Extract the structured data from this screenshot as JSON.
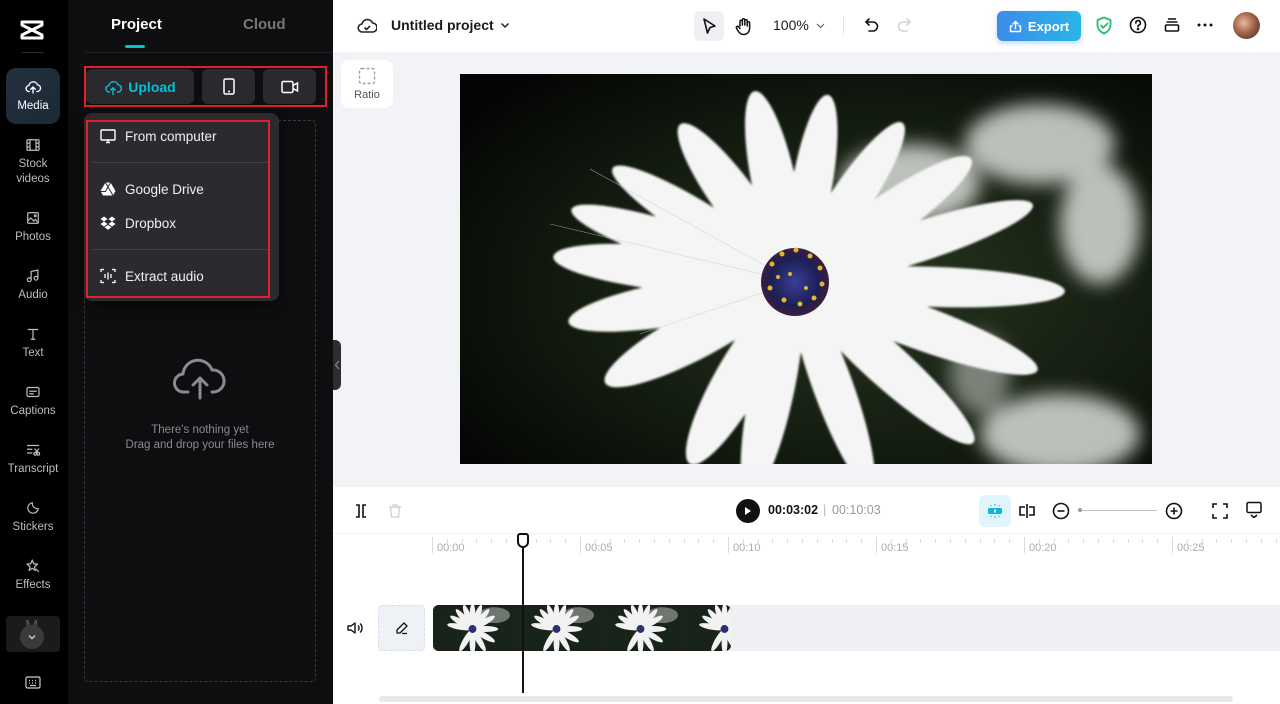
{
  "rail": {
    "items": [
      {
        "id": "media",
        "label": "Media",
        "icon": "cloud-upload-icon",
        "active": true
      },
      {
        "id": "stock-videos",
        "label": "Stock\nvideos",
        "icon": "film-icon"
      },
      {
        "id": "photos",
        "label": "Photos",
        "icon": "image-icon"
      },
      {
        "id": "audio",
        "label": "Audio",
        "icon": "music-note-icon"
      },
      {
        "id": "text",
        "label": "Text",
        "icon": "text-t-icon"
      },
      {
        "id": "captions",
        "label": "Captions",
        "icon": "captions-icon"
      },
      {
        "id": "transcript",
        "label": "Transcript",
        "icon": "transcript-icon"
      },
      {
        "id": "stickers",
        "label": "Stickers",
        "icon": "sticker-icon"
      },
      {
        "id": "effects",
        "label": "Effects",
        "icon": "effects-star-icon"
      }
    ],
    "more_icon": "chevron-down-icon",
    "keyboard_icon": "keyboard-icon"
  },
  "panel": {
    "tabs": [
      {
        "label": "Project",
        "active": true
      },
      {
        "label": "Cloud",
        "active": false
      }
    ],
    "upload_label": "Upload",
    "upload_menu": [
      {
        "label": "From computer",
        "icon": "monitor-icon"
      },
      {
        "label": "Google Drive",
        "icon": "google-drive-icon"
      },
      {
        "label": "Dropbox",
        "icon": "dropbox-icon"
      },
      {
        "label": "Extract audio",
        "icon": "extract-audio-icon"
      }
    ],
    "empty_title": "There's nothing yet",
    "empty_subtitle": "Drag and drop your files here"
  },
  "header": {
    "project_title": "Untitled project",
    "zoom_level": "100%",
    "export_label": "Export",
    "accent_color": "#3e8bea"
  },
  "canvas": {
    "ratio_label": "Ratio"
  },
  "timeline": {
    "current_time": "00:03:02",
    "separator": "|",
    "total_time": "00:10:03",
    "ruler_labels": [
      "00:00",
      "00:05",
      "00:10",
      "00:15",
      "00:20",
      "00:25"
    ],
    "zoom_slider_value": 0
  }
}
